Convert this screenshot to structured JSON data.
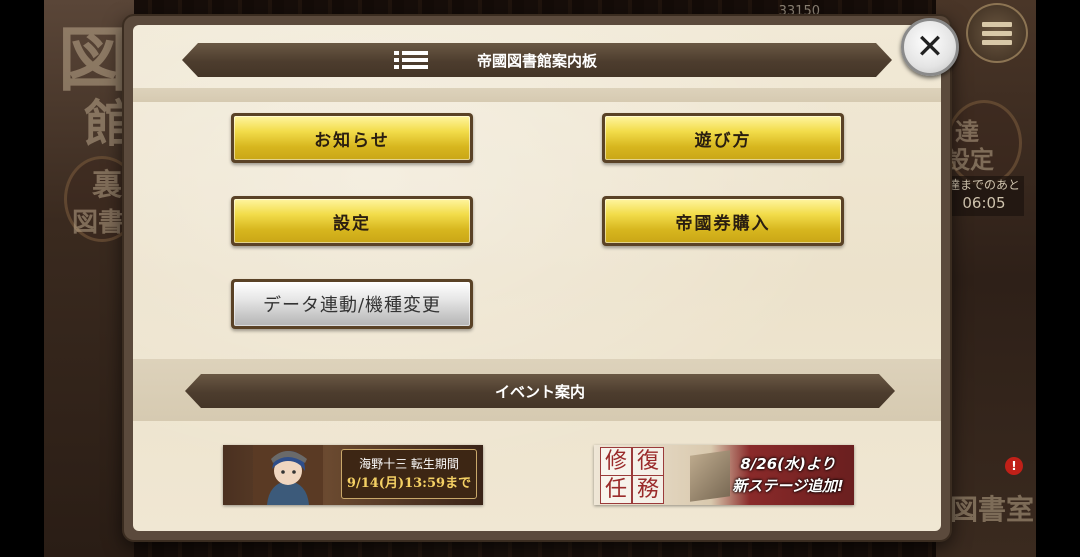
{
  "background": {
    "kanji": [
      "図",
      "館",
      "裏",
      "図書",
      "達",
      "設定",
      "図書室"
    ],
    "counter": "33150",
    "timer_label": "達までのあと",
    "timer_value": "06:05",
    "notify_badge": "!"
  },
  "dialog": {
    "header_title": "帝國図書館案内板",
    "buttons": {
      "notice": "お知らせ",
      "howto": "遊び方",
      "settings": "設定",
      "purchase": "帝國券購入",
      "transfer": "データ連動/機種変更"
    },
    "event_header": "イベント案内",
    "events": [
      {
        "line1": "海野十三 転生期間",
        "line2": "9/14(月)13:59まで"
      },
      {
        "kanji": [
          "修",
          "復",
          "任",
          "務"
        ],
        "line1": "8/26(水)より",
        "line2": "新ステージ追加!"
      }
    ]
  },
  "close_symbol": "✕",
  "colors": {
    "gold_button": "#e9cc3a",
    "silver_button": "#d8d8d8",
    "ribbon": "#4d3d2e",
    "panel": "#efe6d2"
  }
}
